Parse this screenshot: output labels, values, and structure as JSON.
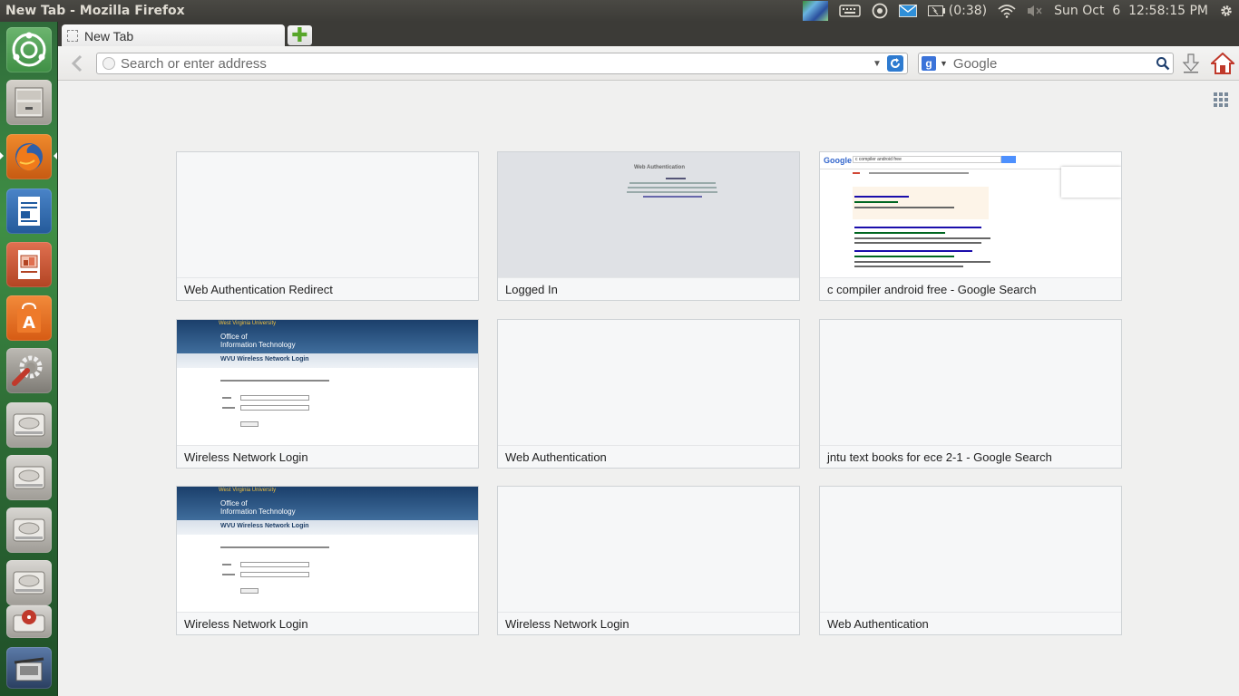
{
  "window": {
    "title": "New Tab - Mozilla Firefox"
  },
  "panel": {
    "battery": "(0:38)",
    "clock": "Sun Oct  6  12:58:15 PM"
  },
  "launcher": {
    "items": [
      {
        "name": "dash-home"
      },
      {
        "name": "files"
      },
      {
        "name": "firefox"
      },
      {
        "name": "libreoffice-writer"
      },
      {
        "name": "libreoffice-impress"
      },
      {
        "name": "ubuntu-software-center"
      },
      {
        "name": "system-settings"
      },
      {
        "name": "drive-1"
      },
      {
        "name": "drive-2"
      },
      {
        "name": "drive-3"
      },
      {
        "name": "drive-4"
      },
      {
        "name": "drive-5"
      },
      {
        "name": "trash"
      }
    ]
  },
  "browser": {
    "tab_label": "New Tab",
    "url_placeholder": "Search or enter address",
    "search_placeholder": "Google",
    "search_engine_letter": "g"
  },
  "newtab": {
    "tiles": [
      {
        "title": "Web Authentication Redirect",
        "thumb": "blank"
      },
      {
        "title": "Logged In",
        "thumb": "grey"
      },
      {
        "title": "c compiler android free - Google Search",
        "thumb": "google"
      },
      {
        "title": "Wireless Network Login",
        "thumb": "wvu"
      },
      {
        "title": "Web Authentication",
        "thumb": "blank"
      },
      {
        "title": "jntu text books for ece 2-1 - Google Search",
        "thumb": "blank"
      },
      {
        "title": "Wireless Network Login",
        "thumb": "wvu"
      },
      {
        "title": "Wireless Network Login",
        "thumb": "blank"
      },
      {
        "title": "Web Authentication",
        "thumb": "blank"
      }
    ],
    "thumb_text": {
      "grey_heading": "Web Authentication",
      "wvu_university": "West Virginia University",
      "wvu_office_line1": "Office of",
      "wvu_office_line2": "Information Technology",
      "wvu_page_title": "WVU Wireless Network Login",
      "google_logo": "Google",
      "google_query": "c compiler android free"
    }
  }
}
